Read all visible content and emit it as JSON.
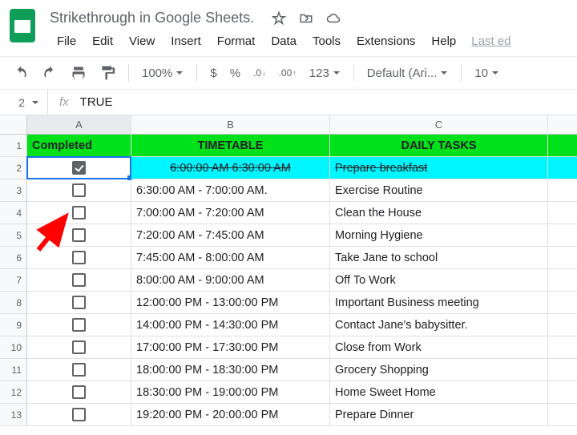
{
  "doc_title": "Strikethrough in Google Sheets.",
  "menus": [
    "File",
    "Edit",
    "View",
    "Insert",
    "Format",
    "Data",
    "Tools",
    "Extensions",
    "Help"
  ],
  "last_edit": "Last ed",
  "toolbar": {
    "zoom": "100%",
    "currency": "$",
    "percent": "%",
    "dec_less": ".0",
    "dec_more": ".00",
    "num_fmt": "123",
    "font": "Default (Ari...",
    "font_size": "10"
  },
  "name_box": "2",
  "fx": "fx",
  "formula": "TRUE",
  "col_labels": [
    "A",
    "B",
    "C"
  ],
  "row_labels": [
    "1",
    "2",
    "3",
    "4",
    "5",
    "6",
    "7",
    "8",
    "9",
    "10",
    "11",
    "12",
    "13"
  ],
  "headers": {
    "a": "Completed",
    "b": "TIMETABLE",
    "c": "DAILY TASKS"
  },
  "rows": [
    {
      "done": true,
      "time": "6:00:00 AM   6:30:00 AM",
      "task": "Prepare breakfast"
    },
    {
      "done": false,
      "time": "6:30:00 AM - 7:00:00 AM.",
      "task": "Exercise Routine"
    },
    {
      "done": false,
      "time": "7:00:00 AM - 7:20:00 AM",
      "task": "Clean the House"
    },
    {
      "done": false,
      "time": "7:20:00 AM - 7:45:00 AM",
      "task": "Morning Hygiene"
    },
    {
      "done": false,
      "time": "7:45:00 AM - 8:00:00 AM",
      "task": "Take Jane to school"
    },
    {
      "done": false,
      "time": "8:00:00 AM - 9:00:00 AM",
      "task": "Off To Work"
    },
    {
      "done": false,
      "time": "12:00:00 PM - 13:00:00 PM",
      "task": "Important Business meeting"
    },
    {
      "done": false,
      "time": "14:00:00 PM - 14:30:00 PM",
      "task": "Contact Jane's babysitter."
    },
    {
      "done": false,
      "time": "17:00:00 PM - 17:30:00 PM",
      "task": "Close from Work"
    },
    {
      "done": false,
      "time": "18:00:00 PM - 18:30:00 PM",
      "task": "Grocery Shopping"
    },
    {
      "done": false,
      "time": "18:30:00 PM - 19:00:00 PM",
      "task": "Home Sweet Home"
    },
    {
      "done": false,
      "time": "19:20:00 PM - 20:00:00 PM",
      "task": "Prepare Dinner"
    }
  ]
}
